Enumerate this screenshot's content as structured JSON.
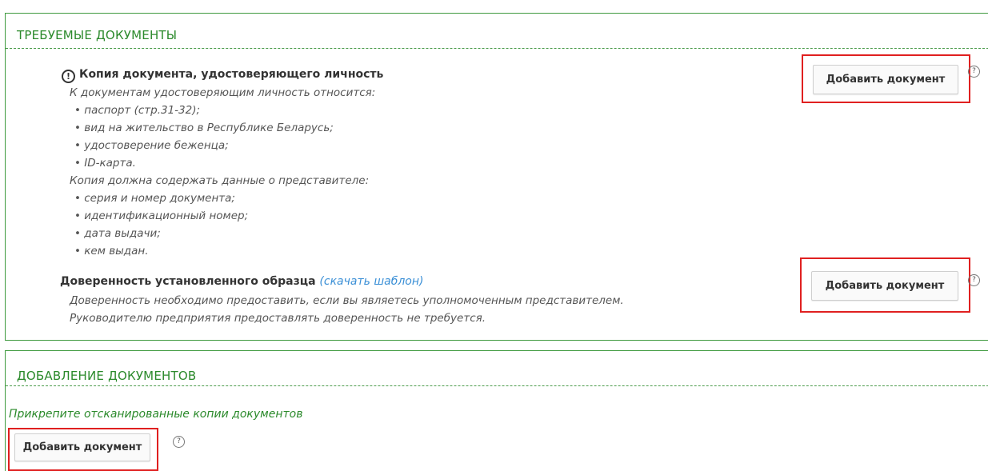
{
  "required_section": {
    "title": "ТРЕБУЕМЫЕ ДОКУМЕНТЫ",
    "doc1": {
      "warning_icon": "warning-circle-icon",
      "title": "Копия документа, удостоверяющего личность",
      "lines": [
        "К документам удостоверяющим личность относится:",
        "• паспорт (стр.31-32);",
        "• вид на жительство в Республике Беларусь;",
        "• удостоверение беженца;",
        "• ID-карта.",
        "Копия должна содержать данные о представителе:",
        "• серия и номер документа;",
        "• идентификационный номер;",
        "• дата выдачи;",
        "• кем выдан."
      ],
      "button_label": "Добавить документ"
    },
    "doc2": {
      "title": "Доверенность установленного образца",
      "template_link": "(скачать шаблон)",
      "lines": [
        "Доверенность необходимо предоставить, если вы являетесь уполномоченным представителем.",
        "Руководителю предприятия предоставлять доверенность не требуется."
      ],
      "button_label": "Добавить документ"
    }
  },
  "add_section": {
    "title": "ДОБАВЛЕНИЕ ДОКУМЕНТОВ",
    "hint": "Прикрепите отсканированные копии документов",
    "button_label": "Добавить документ"
  },
  "help_icon": "?",
  "colors": {
    "accent_green": "#2b8a2b",
    "link_blue": "#3a8fd6",
    "highlight_red": "#e02020"
  }
}
